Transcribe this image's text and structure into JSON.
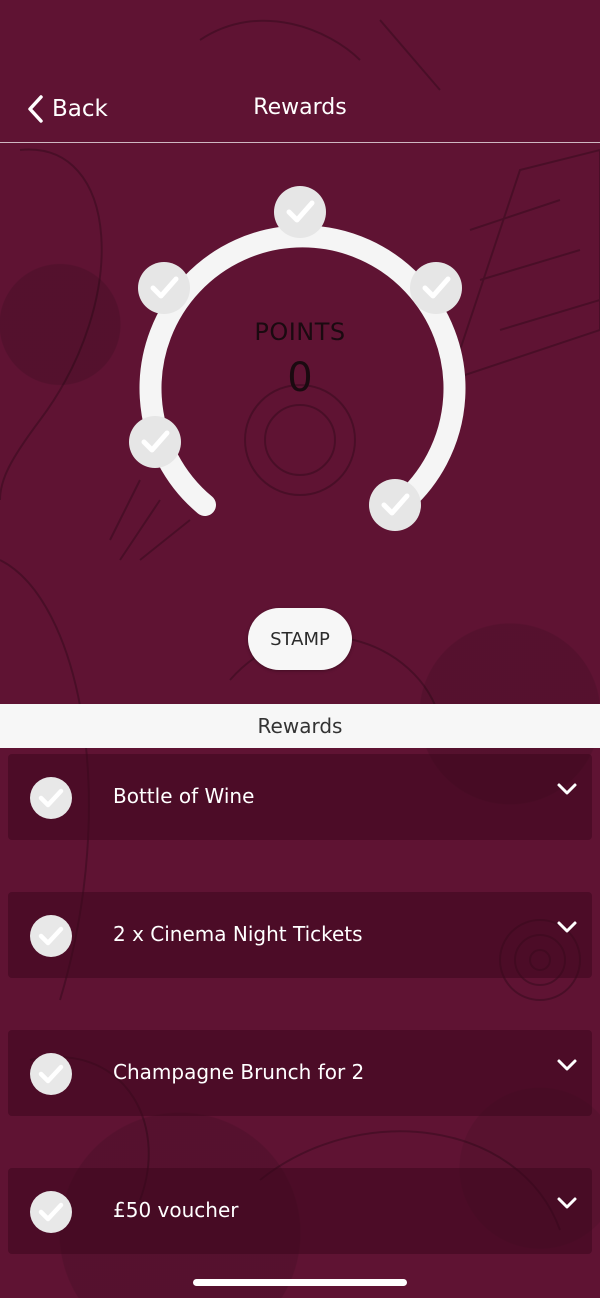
{
  "nav": {
    "back_label": "Back",
    "title": "Rewards"
  },
  "points": {
    "label": "POINTS",
    "value": "0",
    "stamp_label": "STAMP",
    "stamp_count": 5,
    "stamps_filled": 5
  },
  "rewards_section": {
    "title": "Rewards",
    "items": [
      {
        "label": "Bottle of Wine"
      },
      {
        "label": "2 x Cinema Night Tickets"
      },
      {
        "label": "Champagne Brunch for 2"
      },
      {
        "label": "£50 voucher"
      }
    ]
  },
  "icons": {
    "back": "chevron-left-icon",
    "stamp": "checkmark-icon",
    "expand": "chevron-down-icon"
  },
  "colors": {
    "background": "#5f1333",
    "ring": "#f5f5f5",
    "stamp_circle": "#e6e6e6",
    "header_bg": "#f7f7f7"
  }
}
